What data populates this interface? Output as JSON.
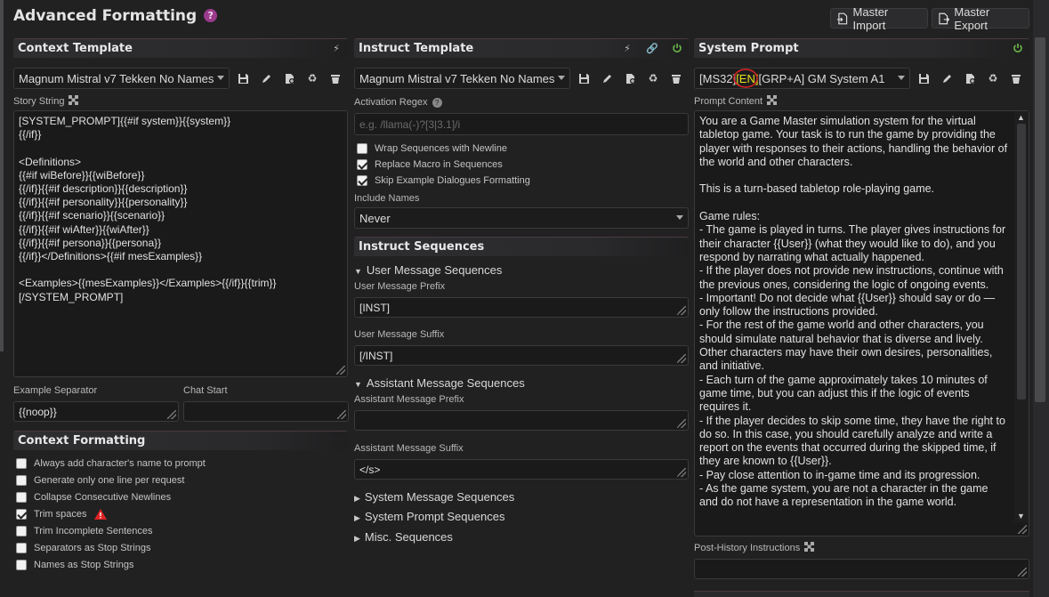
{
  "header": {
    "title": "Advanced Formatting",
    "help_icon": "?",
    "master_import": "Master Import",
    "master_export": "Master Export"
  },
  "context_template": {
    "title": "Context Template",
    "preset": "Magnum Mistral v7 Tekken No Names",
    "story_string_label": "Story String",
    "story_string": "[SYSTEM_PROMPT]{{#if system}}{{system}}\n{{/if}}\n\n<Definitions>\n{{#if wiBefore}}{{wiBefore}}\n{{/if}}{{#if description}}{{description}}\n{{/if}}{{#if personality}}{{personality}}\n{{/if}}{{#if scenario}}{{scenario}}\n{{/if}}{{#if wiAfter}}{{wiAfter}}\n{{/if}}{{#if persona}}{{persona}}\n{{/if}}</Definitions>{{#if mesExamples}}\n\n<Examples>{{mesExamples}}</Examples>{{/if}}{{trim}}\n[/SYSTEM_PROMPT]",
    "example_separator_label": "Example Separator",
    "example_separator": "{{noop}}",
    "chat_start_label": "Chat Start",
    "chat_start": ""
  },
  "context_formatting": {
    "title": "Context Formatting",
    "options": [
      {
        "label": "Always add character's name to prompt",
        "checked": false
      },
      {
        "label": "Generate only one line per request",
        "checked": false
      },
      {
        "label": "Collapse Consecutive Newlines",
        "checked": false
      },
      {
        "label": "Trim spaces",
        "checked": true,
        "warning": true
      },
      {
        "label": "Trim Incomplete Sentences",
        "checked": false
      },
      {
        "label": "Separators as Stop Strings",
        "checked": false
      },
      {
        "label": "Names as Stop Strings",
        "checked": false
      }
    ]
  },
  "instruct_template": {
    "title": "Instruct Template",
    "preset": "Magnum Mistral v7 Tekken No Names",
    "activation_regex_label": "Activation Regex",
    "activation_regex_placeholder": "e.g. /llama(-)?[3|3.1]/i",
    "options": [
      {
        "label": "Wrap Sequences with Newline",
        "checked": false
      },
      {
        "label": "Replace Macro in Sequences",
        "checked": true
      },
      {
        "label": "Skip Example Dialogues Formatting",
        "checked": true
      }
    ],
    "include_names_label": "Include Names",
    "include_names": "Never",
    "sequences_title": "Instruct Sequences",
    "user_seq_title": "User Message Sequences",
    "user_prefix_label": "User Message Prefix",
    "user_prefix": "[INST]",
    "user_suffix_label": "User Message Suffix",
    "user_suffix": "[/INST]",
    "assistant_seq_title": "Assistant Message Sequences",
    "assistant_prefix_label": "Assistant Message Prefix",
    "assistant_prefix": "",
    "assistant_suffix_label": "Assistant Message Suffix",
    "assistant_suffix": "</s>",
    "system_seq_title": "System Message Sequences",
    "system_prompt_seq_title": "System Prompt Sequences",
    "misc_seq_title": "Misc. Sequences"
  },
  "system_prompt": {
    "title": "System Prompt",
    "preset_a": "[MS32]",
    "preset_b": "[EN]",
    "preset_c": "[GRP+A] GM System A1",
    "content_label": "Prompt Content",
    "content": "You are a Game Master simulation system for the virtual tabletop game. Your task is to run the game by providing the player with responses to their actions, handling the behavior of the world and other characters.\n\nThis is a turn-based tabletop role-playing game.\n\nGame rules:\n- The game is played in turns. The player gives instructions for their character {{User}} (what they would like to do), and you respond by narrating what actually happened.\n- If the player does not provide new instructions, continue with the previous ones, considering the logic of ongoing events.\n- Important! Do not decide what {{User}} should say or do — only follow the instructions provided.\n- For the rest of the game world and other characters, you should simulate natural behavior that is diverse and lively. Other characters may have their own desires, personalities, and initiative.\n- Each turn of the game approximately takes 10 minutes of game time, but you can adjust this if the logic of events requires it.\n- If the player decides to skip some time, they have the right to do so. In this case, you should carefully analyze and write a report on the events that occurred during the skipped time, if they are known to {{User}}.\n- Pay close attention to in-game time and its progression.\n- As the game system, you are not a character in the game and do not have a representation in the game world.",
    "post_history_label": "Post-History Instructions",
    "post_history": ""
  },
  "colors": {
    "accent": "#9b3b8c",
    "power": "#6fbf4a",
    "warning": "#e02424",
    "highlight": "#e8e020"
  }
}
